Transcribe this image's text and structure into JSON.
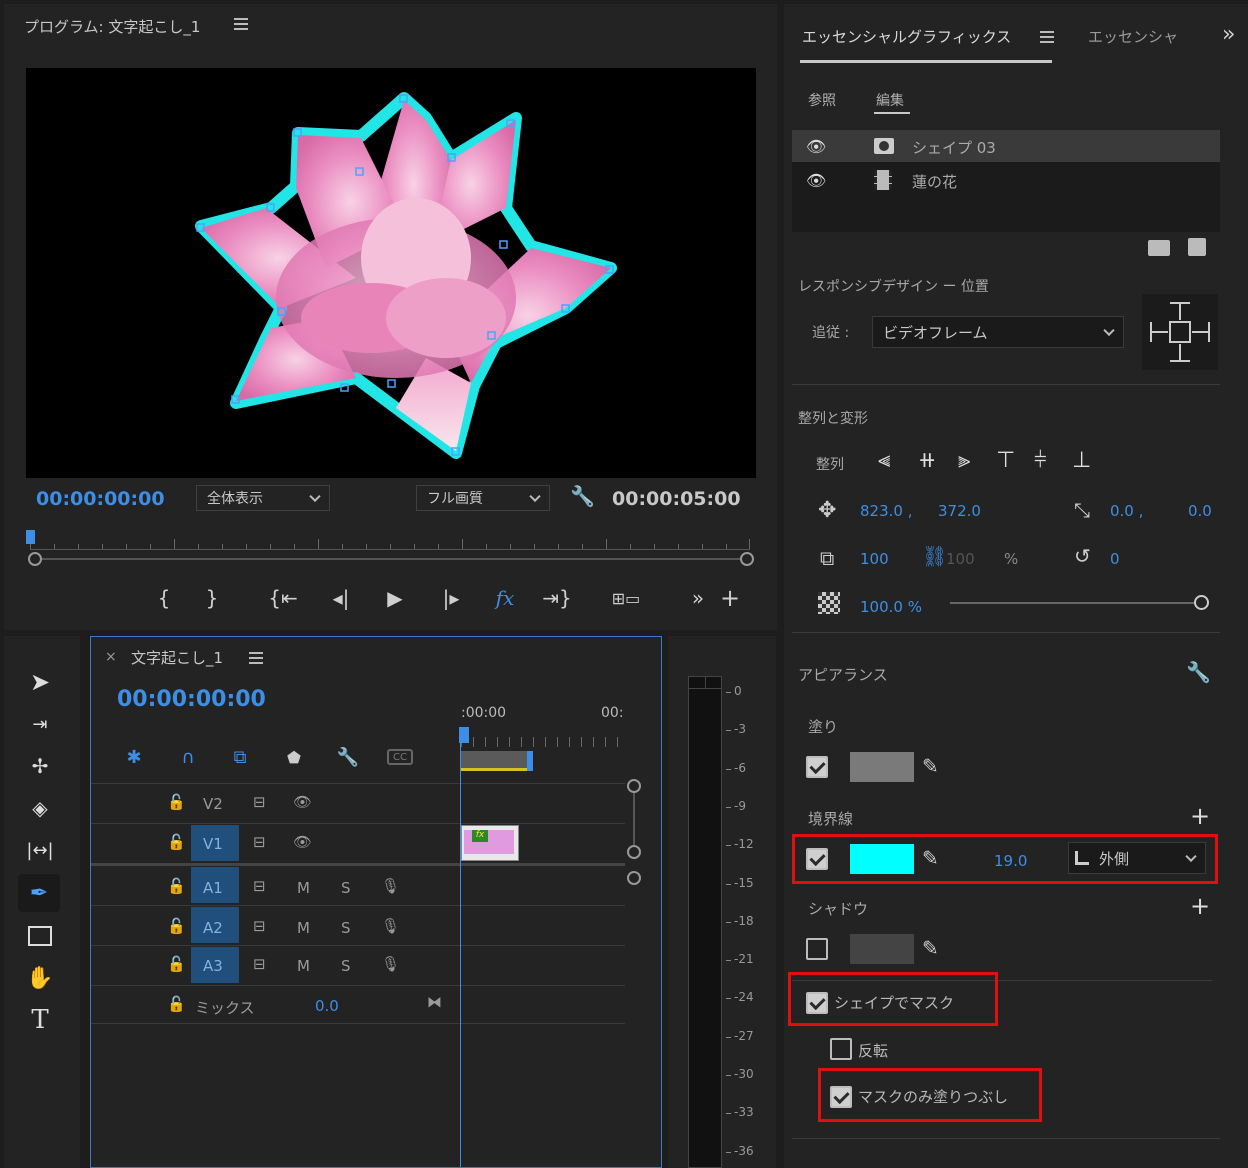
{
  "program_monitor": {
    "title": "プログラム: 文字起こし_1",
    "timecode_current": "00:00:00:00",
    "zoom_select": "全体表示",
    "quality_select": "フル画質",
    "timecode_duration": "00:00:05:00"
  },
  "essential_graphics": {
    "tab_active": "エッセンシャルグラフィックス",
    "tab_other": "エッセンシャ",
    "subtab_browse": "参照",
    "subtab_edit": "編集",
    "layers": [
      {
        "name": "シェイプ 03"
      },
      {
        "name": "蓮の花"
      }
    ],
    "responsive_title": "レスポンシブデザイン ー 位置",
    "follow_label": "追従 :",
    "follow_value": "ビデオフレーム",
    "align_title": "整列と変形",
    "align_label": "整列",
    "pos_x": "823.0 ,",
    "pos_y": "372.0",
    "anchor_x": "0.0 ,",
    "anchor_y": "0.0",
    "scale": "100",
    "scale_linked": "100",
    "scale_unit": "%",
    "rotation": "0",
    "opacity": "100.0 %",
    "appearance_title": "アピアランス",
    "fill_label": "塗り",
    "fill_color": "#7a7a7a",
    "stroke_label": "境界線",
    "stroke_color": "#00ffff",
    "stroke_width": "19.0",
    "stroke_position": "外側",
    "shadow_label": "シャドウ",
    "shadow_color": "#444444",
    "mask_with_shape": "シェイプでマスク",
    "invert": "反転",
    "fill_mask_only": "マスクのみ塗りつぶし"
  },
  "timeline": {
    "sequence_tab": "文字起こし_1",
    "timecode": "00:00:00:00",
    "ruler_start": ":00:00",
    "ruler_next": "00:",
    "tracks": [
      {
        "name": "V2"
      },
      {
        "name": "V1"
      },
      {
        "name": "A1",
        "m": "M",
        "s": "S"
      },
      {
        "name": "A2",
        "m": "M",
        "s": "S"
      },
      {
        "name": "A3",
        "m": "M",
        "s": "S"
      }
    ],
    "mix_label": "ミックス",
    "mix_value": "0.0",
    "clip_fx": "fx"
  },
  "audio_meter": {
    "scale": [
      "0",
      "-3",
      "-6",
      "-9",
      "-12",
      "-15",
      "-18",
      "-21",
      "-24",
      "-27",
      "-30",
      "-33",
      "-36"
    ]
  },
  "colors": {
    "accent_blue": "#3d8ee6",
    "highlight_red": "#e01010",
    "track_blue": "#1f4f7a"
  }
}
